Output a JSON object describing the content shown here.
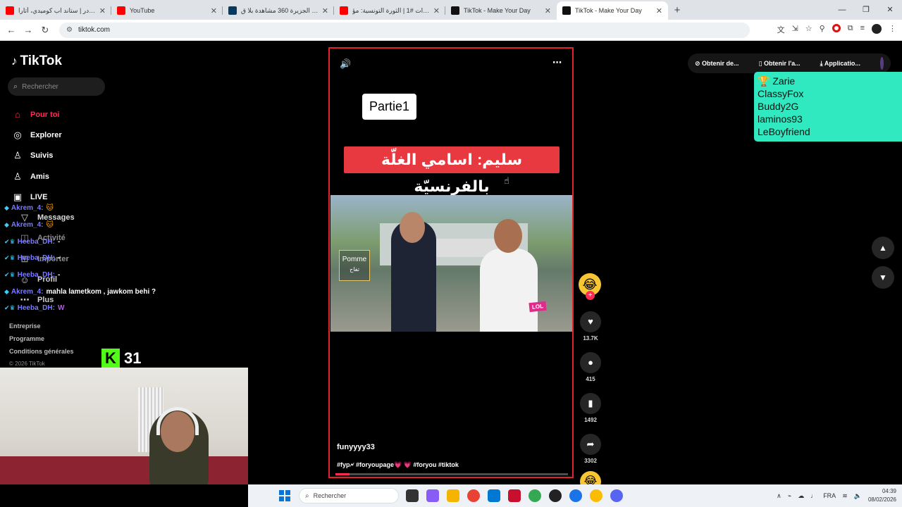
{
  "browser": {
    "tabs": [
      {
        "title": "ميتا نادر | ستاند اب كوميدي، أتارا...",
        "color": "#ff0000"
      },
      {
        "title": "YouTube",
        "color": "#ff0000"
      },
      {
        "title": "منصة الجزيرة 360 مشاهدة بلا ق...",
        "color": "#0b3b5c"
      },
      {
        "title": "مؤامرات #1 | الثورة التونسية: مؤ...",
        "color": "#ff0000"
      },
      {
        "title": "TikTok - Make Your Day",
        "color": "#111111"
      },
      {
        "title": "TikTok - Make Your Day",
        "color": "#111111",
        "active": true
      }
    ],
    "url": "tiktok.com"
  },
  "tiktok": {
    "logo": "TikTok",
    "search_placeholder": "Rechercher",
    "nav": [
      {
        "label": "Pour toi",
        "icon": "home-icon",
        "active": true
      },
      {
        "label": "Explorer",
        "icon": "compass-icon"
      },
      {
        "label": "Suivis",
        "icon": "user-icon"
      },
      {
        "label": "Amis",
        "icon": "friends-icon"
      },
      {
        "label": "LIVE",
        "icon": "live-icon"
      },
      {
        "label": "Messages",
        "icon": "messages-icon"
      },
      {
        "label": "Activité",
        "icon": "activity-icon"
      },
      {
        "label": "Importer",
        "icon": "upload-icon"
      },
      {
        "label": "Profil",
        "icon": "profile-icon"
      },
      {
        "label": "Plus",
        "icon": "more-icon"
      }
    ],
    "footer": [
      "Entreprise",
      "Programme",
      "Conditions générales"
    ],
    "copyright": "© 2026 TikTok",
    "header_actions": [
      "Obtenir de...",
      "Obtenir l'a...",
      "Applicatio..."
    ]
  },
  "chat": [
    {
      "user": "Akrem_4:",
      "message": "🐱"
    },
    {
      "user": "Akrem_4:",
      "message": "🐱"
    },
    {
      "user": "Heeba_DH:",
      "message": "-"
    },
    {
      "user": "Heeba_DH:",
      "message": "-"
    },
    {
      "user": "Heeba_DH:",
      "message": "-"
    },
    {
      "user": "Akrem_4:",
      "message": "mahla lametkom , jawkom behi ?"
    },
    {
      "user": "Heeba_DH:",
      "message": "W"
    }
  ],
  "kick_counter": "31",
  "video": {
    "part_label": "Partie1",
    "arabic_title": "سليم: اسامي الغلّة بالفرنسيّة",
    "overlay_fr": "Pomme",
    "overlay_ar": "تفاح",
    "author": "funyyyy33",
    "hashtags": "#fyp🗲 #foryoupage💗 💗 #foryou #tiktok",
    "progress": 0.06
  },
  "actions": {
    "likes": "13.7K",
    "comments": "415",
    "saves": "1492",
    "shares": "3302"
  },
  "leaderboard": [
    "🏆 Zarie",
    "ClassyFox",
    "Buddy2G",
    "laminos93",
    "LeBoyfriend"
  ],
  "taskbar": {
    "search_placeholder": "Rechercher",
    "lang": "FRA",
    "time": "04:39",
    "date": "08/02/2026"
  }
}
